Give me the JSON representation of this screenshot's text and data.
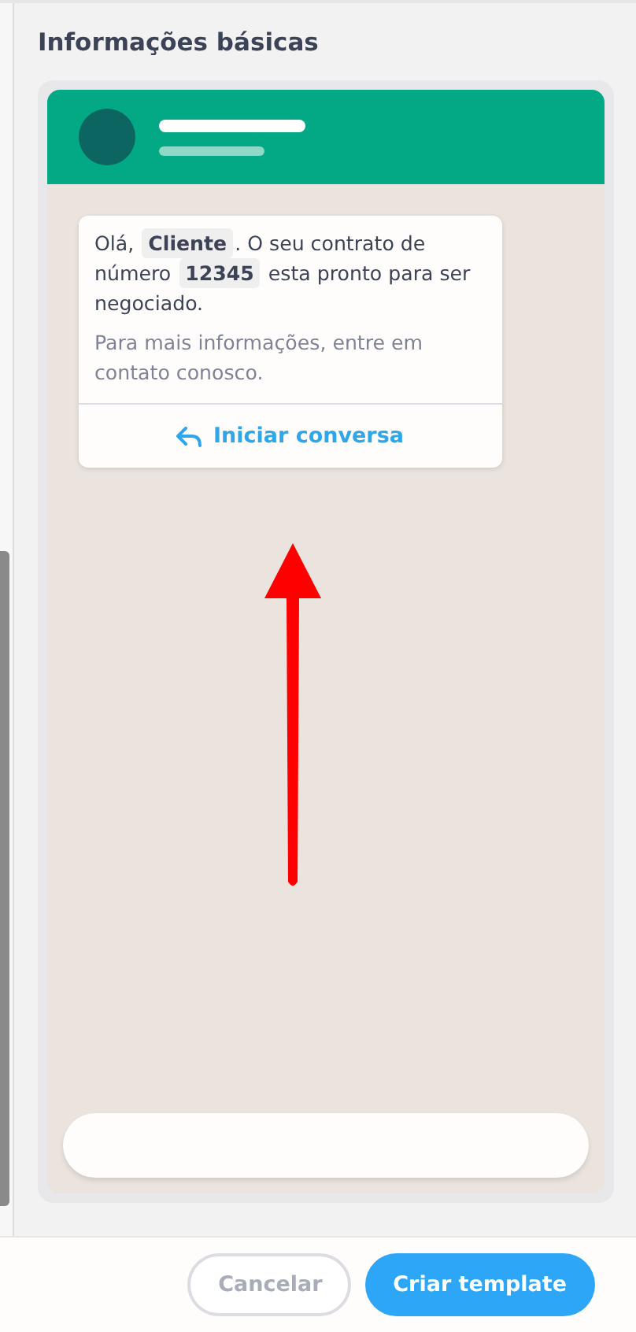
{
  "section_title": "Informações básicas",
  "preview": {
    "message": [
      {
        "kind": "text",
        "text": "Olá, "
      },
      {
        "kind": "variable",
        "text": "Cliente"
      },
      {
        "kind": "text",
        "text": ". O seu contrato de número "
      },
      {
        "kind": "variable",
        "text": "12345"
      },
      {
        "kind": "text",
        "text": " esta pronto para ser negociado."
      }
    ],
    "footer": "Para mais informações, entre em contato conosco.",
    "reply_button": "Iniciar conversa"
  },
  "buttons": [
    {
      "label": "Cancelar",
      "kind": "secondary"
    },
    {
      "label": "Criar template",
      "kind": "primary"
    }
  ]
}
